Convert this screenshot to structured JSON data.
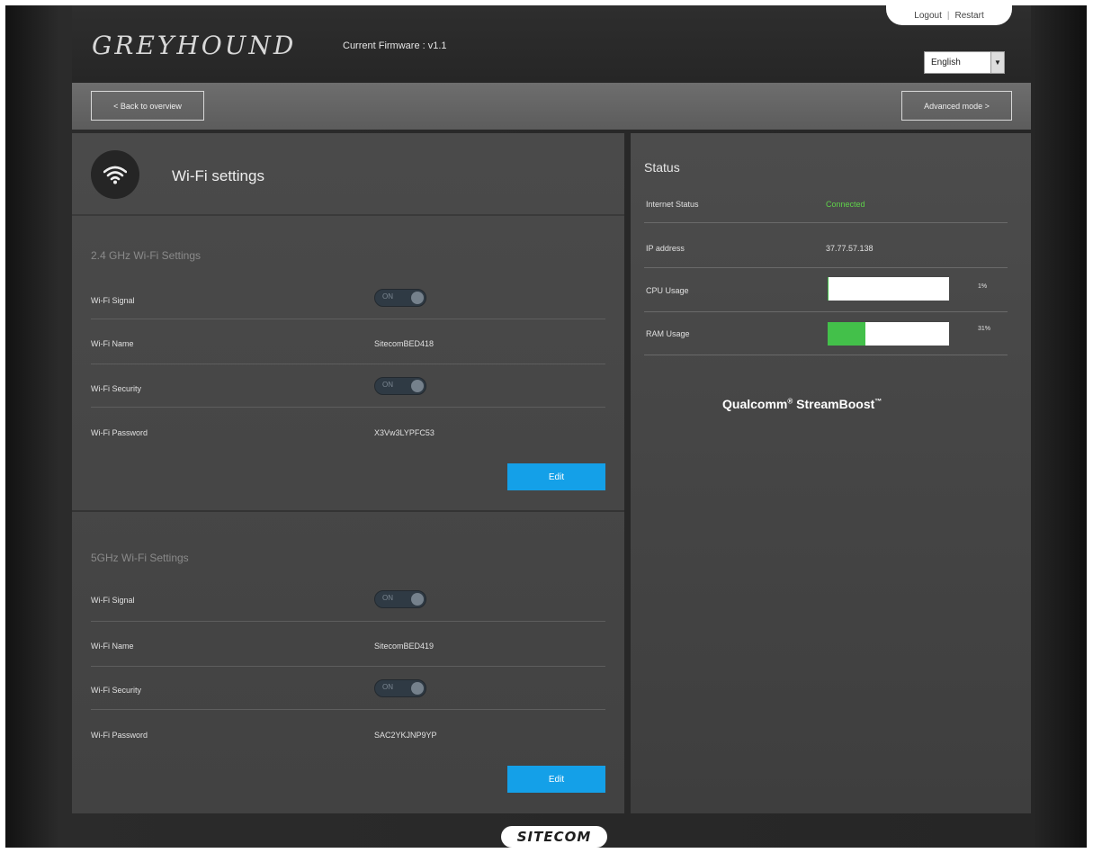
{
  "header": {
    "brand": "GREYHOUND",
    "firmware_label": "Current Firmware : v1.1",
    "logout_label": "Logout",
    "restart_label": "Restart",
    "language_selected": "English"
  },
  "nav": {
    "back_label": "< Back to overview",
    "advanced_label": "Advanced mode >"
  },
  "wifi": {
    "title": "Wi-Fi settings",
    "band24": {
      "title": "2.4 GHz Wi-Fi Settings",
      "signal_label": "Wi-Fi Signal",
      "signal_state": "ON",
      "name_label": "Wi-Fi Name",
      "name_value": "SitecomBED418",
      "security_label": "Wi-Fi Security",
      "security_state": "ON",
      "password_label": "Wi-Fi Password",
      "password_value": "X3Vw3LYPFC53",
      "edit_label": "Edit"
    },
    "band5": {
      "title": "5GHz Wi-Fi Settings",
      "signal_label": "Wi-Fi Signal",
      "signal_state": "ON",
      "name_label": "Wi-Fi Name",
      "name_value": "SitecomBED419",
      "security_label": "Wi-Fi Security",
      "security_state": "ON",
      "password_label": "Wi-Fi Password",
      "password_value": "SAC2YKJNP9YP",
      "edit_label": "Edit"
    }
  },
  "status": {
    "title": "Status",
    "internet_label": "Internet Status",
    "internet_value": "Connected",
    "internet_color": "#5fd24a",
    "ip_label": "IP address",
    "ip_value": "37.77.57.138",
    "cpu_label": "CPU Usage",
    "cpu_percent": 1,
    "cpu_text": "1%",
    "ram_label": "RAM Usage",
    "ram_percent": 31,
    "ram_text": "31%",
    "qualcomm_label": "Qualcomm",
    "streamboost_label": "StreamBoost"
  },
  "footer": {
    "logo": "SITECOM"
  },
  "colors": {
    "edit_button": "#14a0e8",
    "usage_bar": "#43c04a"
  }
}
